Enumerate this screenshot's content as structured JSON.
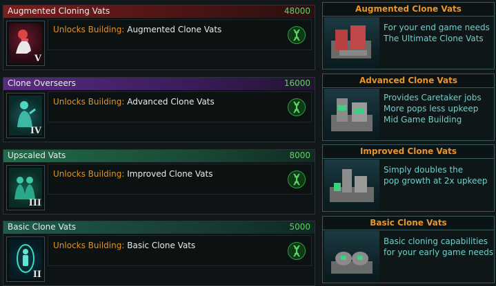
{
  "techs": [
    {
      "title": "Augmented Cloning Vats",
      "cost": "48000",
      "tier": "V",
      "unlock_prefix": "Unlocks Building:",
      "unlock_target": "Augmented Clone Vats",
      "icon": "augmented-clone-icon",
      "header_color": "#6a1a1a"
    },
    {
      "title": "Clone Overseers",
      "cost": "16000",
      "tier": "IV",
      "unlock_prefix": "Unlocks Building:",
      "unlock_target": "Advanced Clone Vats",
      "icon": "overseer-clone-icon",
      "header_color": "#4a1e6a"
    },
    {
      "title": "Upscaled Vats",
      "cost": "8000",
      "tier": "III",
      "unlock_prefix": "Unlocks Building:",
      "unlock_target": "Improved Clone Vats",
      "icon": "upscaled-clone-icon",
      "header_color": "#1c4a36"
    },
    {
      "title": "Basic Clone Vats",
      "cost": "5000",
      "tier": "II",
      "unlock_prefix": "Unlocks Building:",
      "unlock_target": "Basic Clone Vats",
      "icon": "basic-clone-icon",
      "header_color": "#1c4a40"
    }
  ],
  "cards": [
    {
      "title": "Augmented Clone Vats",
      "lines": [
        "For your end game needs",
        "The Ultimate Clone Vats"
      ],
      "icon": "augmented-vat-building-icon"
    },
    {
      "title": "Advanced Clone Vats",
      "lines": [
        "Provides Caretaker jobs",
        "More pops less upkeep",
        "Mid Game Building"
      ],
      "icon": "advanced-vat-building-icon"
    },
    {
      "title": "Improved Clone Vats",
      "lines": [
        "Simply doubles the",
        "pop growth at 2x upkeep"
      ],
      "icon": "improved-vat-building-icon"
    },
    {
      "title": "Basic Clone Vats",
      "lines": [
        "Basic cloning capabilities",
        "for your early game needs"
      ],
      "icon": "basic-vat-building-icon"
    }
  ],
  "colors": {
    "cost": "#5bd65b",
    "unlock_prefix": "#e0922a",
    "card_title": "#e8942a",
    "card_desc": "#6fd1c9",
    "dna_icon": "#2fa13a"
  }
}
